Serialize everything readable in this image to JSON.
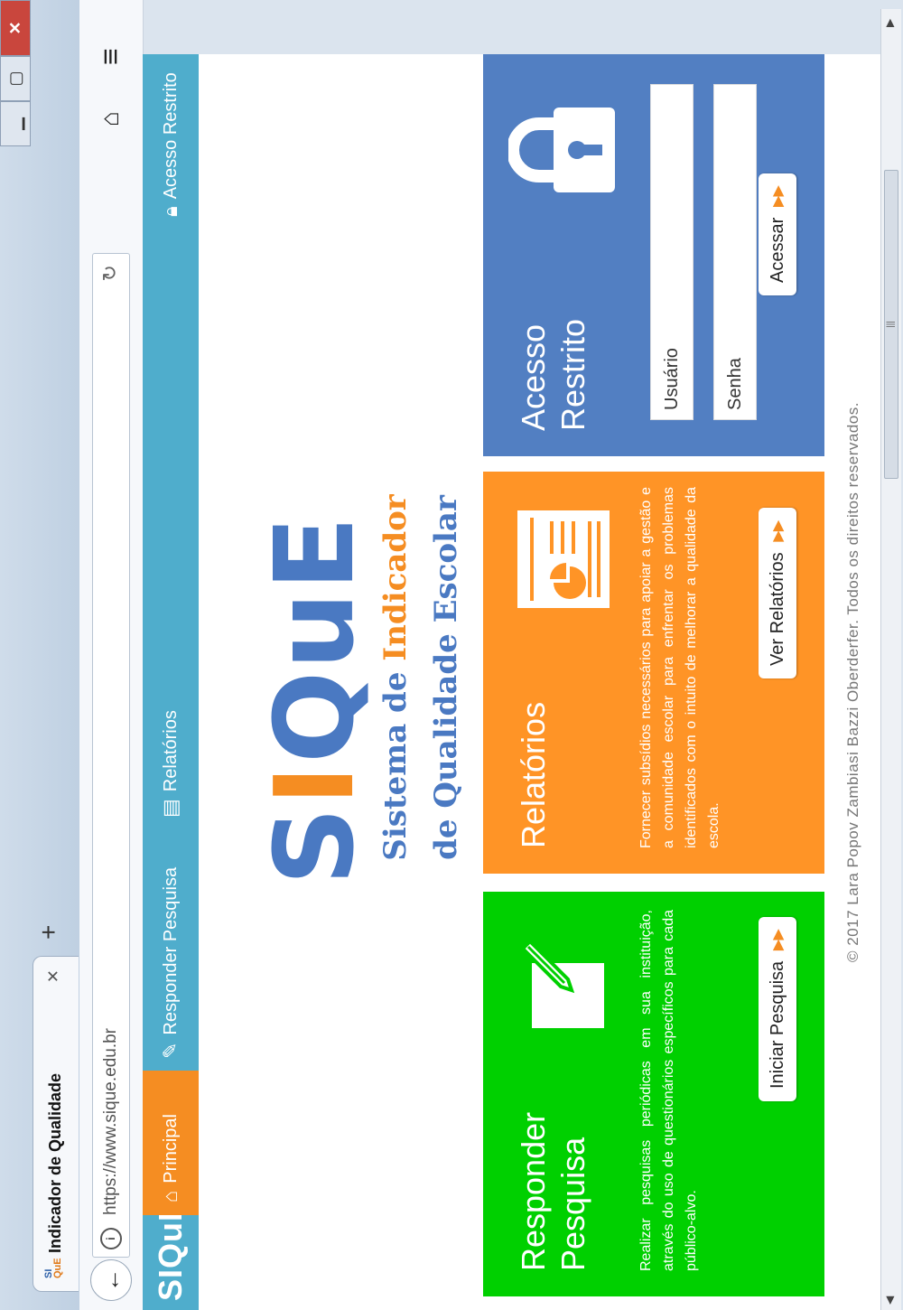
{
  "browser": {
    "tab_title": "Indicador de Qualidade",
    "tab_logo_top": "SI",
    "tab_logo_bottom": "QuE",
    "url": "https://www.sique.edu.br"
  },
  "site": {
    "brand": "SIQuE",
    "nav": {
      "principal": "Principal",
      "responder": "Responder Pesquisa",
      "relatorios": "Relatórios",
      "acesso": "Acesso Restrito"
    },
    "logo": {
      "part1": "S",
      "part2": "I",
      "part3": "QuE"
    },
    "tagline": {
      "pre": "Sistema de ",
      "highlight": "Indicador",
      "post": "de Qualidade Escolar"
    }
  },
  "cards": {
    "pesquisa": {
      "title_line1": "Responder",
      "title_line2": "Pesquisa",
      "text": "Realizar pesquisas periódicas em sua instituição, através do uso de questionários específicos para cada público-alvo.",
      "button": "Iniciar Pesquisa",
      "icon": "pencil-paper-icon"
    },
    "relatorios": {
      "title": "Relatórios",
      "text": "Fornecer subsídios necessários para apoiar a gestão e a comunidade escolar para enfrentar os problemas identificados com o intuito de melhorar a qualidade da escola.",
      "button": "Ver Relatórios",
      "icon": "report-document-icon"
    },
    "acesso": {
      "title_line1": "Acesso",
      "title_line2": "Restrito",
      "user_placeholder": "Usuário",
      "pass_placeholder": "Senha",
      "button": "Acessar",
      "icon": "lock-icon"
    }
  },
  "footer": "© 2017 Lara Popov Zambiasi Bazzi Oberderfer. Todos os direitos reservados.",
  "colors": {
    "green": "#00d000",
    "orange": "#ff9426",
    "blue": "#527fc2",
    "header": "#4fadcc"
  }
}
